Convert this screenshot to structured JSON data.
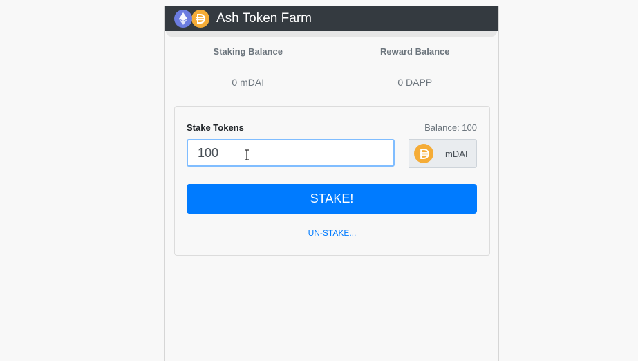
{
  "app": {
    "title": "Ash Token Farm",
    "icons": [
      "ethereum-icon",
      "dai-icon"
    ]
  },
  "balances": {
    "staking_label": "Staking Balance",
    "staking_value": "0 mDAI",
    "reward_label": "Reward Balance",
    "reward_value": "0 DAPP"
  },
  "stake_form": {
    "label": "Stake Tokens",
    "balance_text": "Balance: 100",
    "amount_value": "100",
    "token_icon": "dai-icon",
    "token_label": "mDAI",
    "stake_button": "STAKE!",
    "unstake_link": "UN-STAKE..."
  },
  "colors": {
    "navbar": "#343a40",
    "primary": "#007bff",
    "eth": "#6b7ce0",
    "dai": "#f5ac37"
  }
}
